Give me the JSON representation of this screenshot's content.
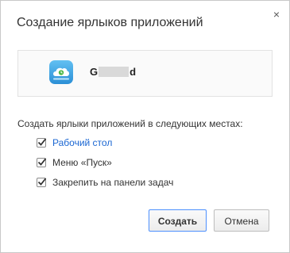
{
  "dialog": {
    "title": "Создание ярлыков приложений",
    "close_symbol": "×"
  },
  "app": {
    "name_start": "G",
    "name_end": "d",
    "icon": "cloud-app-icon",
    "icon_color": "#3ba3e0"
  },
  "shortcuts": {
    "prompt": "Создать ярлыки приложений в следующих местах:",
    "options": [
      {
        "label": "Рабочий стол",
        "checked": true
      },
      {
        "label": "Меню «Пуск»",
        "checked": true
      },
      {
        "label": "Закрепить на панели задач",
        "checked": true
      }
    ]
  },
  "buttons": {
    "create_label": "Создать",
    "cancel_label": "Отмена"
  },
  "colors": {
    "accent": "#4d90fe",
    "app_title_link": "#1a66d2"
  }
}
